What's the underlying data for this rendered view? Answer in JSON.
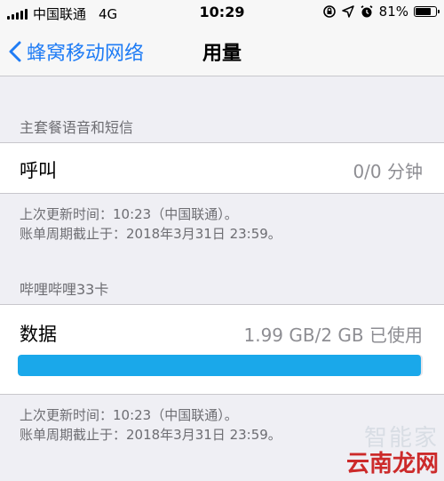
{
  "status_bar": {
    "carrier": "中国联通",
    "network": "4G",
    "time": "10:29",
    "battery_percent": "81%",
    "battery_level": 0.81
  },
  "nav": {
    "back_label": "蜂窝移动网络",
    "title": "用量"
  },
  "sections": {
    "plan": {
      "header": "主套餐语音和短信",
      "call_label": "呼叫",
      "call_value": "0/0 分钟",
      "footer_line1": "上次更新时间：10:23（中国联通）。",
      "footer_line2": "账单周期截止于：2018年3月31日 23:59。"
    },
    "card": {
      "header": "哔哩哔哩33卡",
      "data_label": "数据",
      "data_value": "1.99 GB/2 GB 已使用",
      "data_used_fraction": 0.995,
      "footer_line1": "上次更新时间：10:23（中国联通）。",
      "footer_line2": "账单周期截止于：2018年3月31日 23:59。"
    }
  },
  "watermark": {
    "light_text": "智能家",
    "brand_text": "云南龙网"
  },
  "colors": {
    "accent": "#1f7cf5",
    "progress": "#1aa8ea",
    "brand_red": "#cc2a2a"
  }
}
